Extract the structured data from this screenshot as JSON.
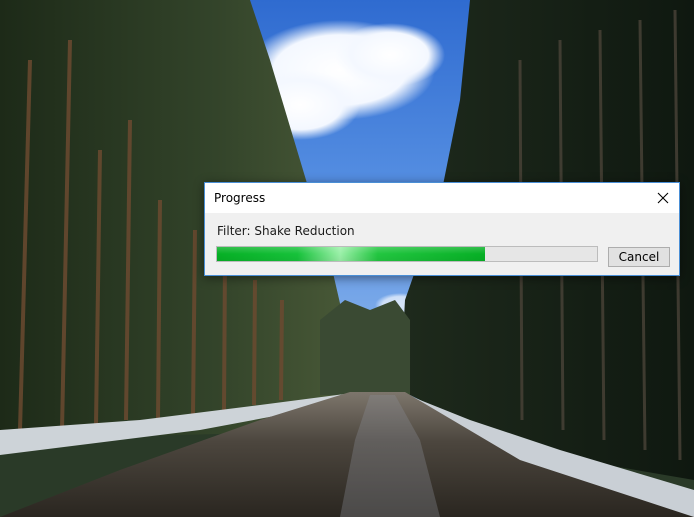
{
  "dialog": {
    "title": "Progress",
    "status_text": "Filter: Shake Reduction",
    "progress_fraction": 0.705,
    "cancel_label": "Cancel",
    "close_icon": "close-icon",
    "accent_color": "#06b025",
    "border_color": "#4a8fd6"
  }
}
